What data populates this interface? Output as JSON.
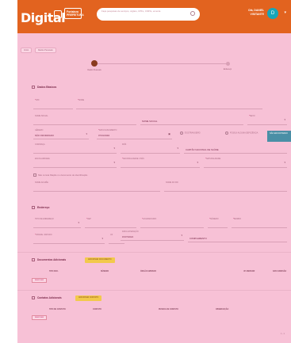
{
  "header": {
    "brand": "Digital",
    "partner": "Fortaleza",
    "partner_sub": "PREFEITURA",
    "search_placeholder": "Faça pesquisas de serviços, órgãos, CPFs, CNPJs, ementa",
    "user_name": "Olá, DANIEL",
    "user_sub": "VISITANTE",
    "avatar_initial": "D"
  },
  "breadcrumb": [
    "Início",
    "Dados Pessoais"
  ],
  "steps": [
    "Dados Pessoais",
    "Endereço"
  ],
  "sections": {
    "basic": "Dados Básicos",
    "address": "Endereço",
    "documents": "Documentos Adicionais",
    "contacts": "Contatos Adicionais"
  },
  "basic_fields": {
    "cpf": "CPF",
    "nome": "NOME",
    "nome_social": "NOME SOCIAL",
    "nome_social_text": "NOME SOCIAL",
    "sexo": "SEXO",
    "genero": "GÊNERO",
    "genero_val": "NÃO INFORMADO",
    "nascimento": "DATA NASCIMENTO",
    "nascimento_val": "07/01/1994",
    "raca": "COR/RAÇA",
    "pais": "PAÍS",
    "cartao_sus": "CARTÃO NACIONAL DE SAÚDE",
    "escolaridade": "ESCOLARIDADE",
    "nacionalidade": "NACIONALIDADE / PAÍS",
    "naturalidade": "NATURALIDADE",
    "filiacao_check": "Não consta filiação no documento de identificação",
    "mae": "NOME DA MÃE",
    "pai": "NOME DO PAI",
    "teal_button": "NÃO ENCONTRADO",
    "estrangeiro": "É ESTRANGEIRO",
    "deficiencia": "POSSUI ALGUMA DEFICIÊNCIA"
  },
  "address_fields": {
    "tipo": "TIPO DE ENDEREÇO",
    "cep": "CEP",
    "logradouro": "LOGRADOURO",
    "numero": "NÚMERO",
    "bairro": "BAIRRO",
    "cidade": "CIDADE / ESTADO",
    "uf": "UF",
    "data": "DATA ALTERAÇÃO",
    "data_val": "15/07/2024",
    "complemento": "COMPLEMENTO"
  },
  "documents": {
    "add_button": "ADICIONAR DOCUMENTO",
    "columns": [
      "TIPO DOC.",
      "NÚMERO",
      "ÓRGÃO EMISSOR",
      "UF EMISSOR",
      "DATA EMISSÃO"
    ],
    "remove_label": "REMOVER"
  },
  "contacts": {
    "add_button": "ADICIONAR CONTATO",
    "columns": [
      "TIPO DE CONTATO",
      "CONTATO",
      "PESSOA DE CONTATO",
      "OBSERVAÇÃO"
    ],
    "remove_label": "REMOVER",
    "pager": "1 - 1"
  }
}
